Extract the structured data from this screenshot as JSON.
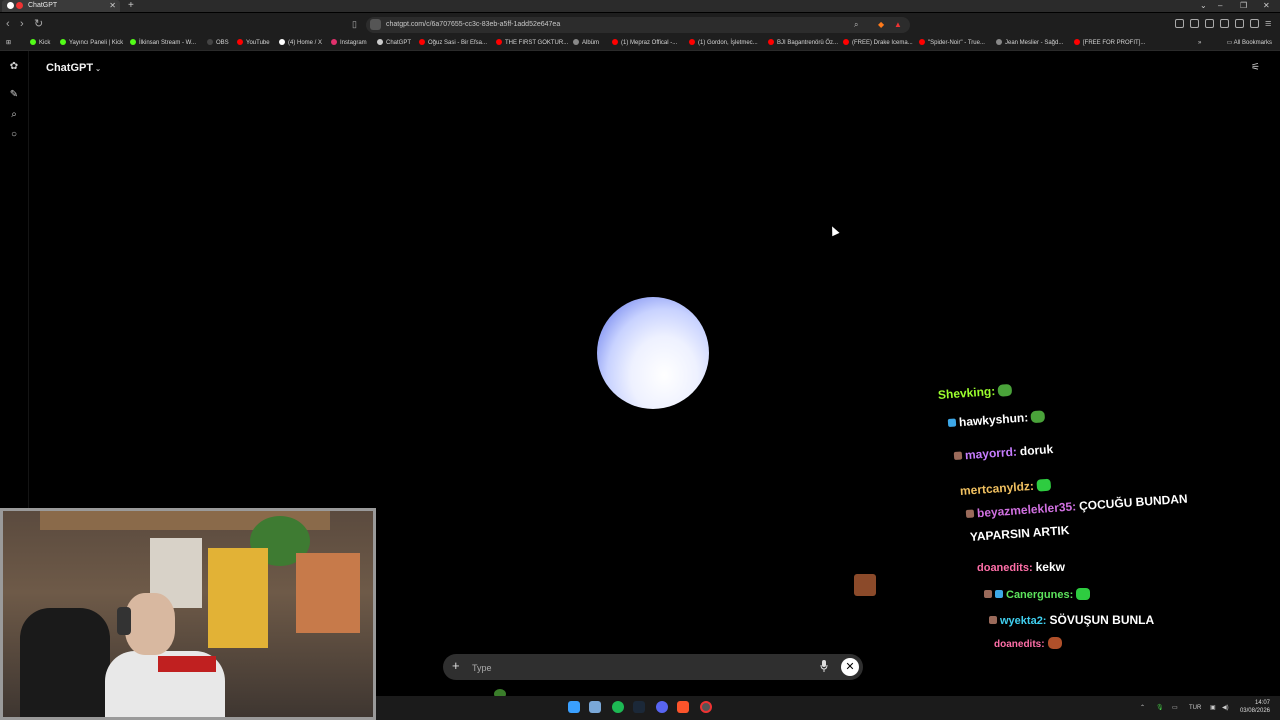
{
  "browser": {
    "tab_title": "ChatGPT",
    "new_tab": "+",
    "url": "chatgpt.com/c/6a707655-cc3c-83eb-a5ff-1add52e647ea",
    "bookmarks": [
      {
        "label": "Kick",
        "color": "#53fc18"
      },
      {
        "label": "Yayıncı Paneli | Kick",
        "color": "#53fc18"
      },
      {
        "label": "İlkinsan Stream - W...",
        "color": "#53fc18"
      },
      {
        "label": "OBS",
        "color": "#444444"
      },
      {
        "label": "YouTube",
        "color": "#ff0000"
      },
      {
        "label": "(4) Home / X",
        "color": "#ffffff"
      },
      {
        "label": "Instagram",
        "color": "#e1306c"
      },
      {
        "label": "ChatGPT",
        "color": "#cccccc"
      },
      {
        "label": "Oğuz Sasi - Bir Efsa...",
        "color": "#ff0000"
      },
      {
        "label": "THE FIRST GOKTUR...",
        "color": "#ff0000"
      },
      {
        "label": "Albüm",
        "color": "#888888"
      },
      {
        "label": "(1) Mepraz Offical -...",
        "color": "#ff0000"
      },
      {
        "label": "(1) Gordon, İşletmec...",
        "color": "#ff0000"
      },
      {
        "label": "BJI Bagantrenörü Öz...",
        "color": "#ff0000"
      },
      {
        "label": "(FREE) Drake Icema...",
        "color": "#ff0000"
      },
      {
        "label": "\"Spider-Noir\" - True...",
        "color": "#ff0000"
      },
      {
        "label": "Jean Meslier - Sağd...",
        "color": "#888888"
      },
      {
        "label": "[FREE FOR PROFIT]...",
        "color": "#ff0000"
      }
    ],
    "all_bookmarks": "All Bookmarks"
  },
  "app": {
    "brand": "ChatGPT",
    "caret": "⌄"
  },
  "composer": {
    "plus": "+",
    "placeholder": "Type",
    "end_symbol": "✕"
  },
  "chat_overlay": [
    {
      "user": "Shevking:",
      "user_color": "#9cff2e",
      "text": "",
      "emote": "pepe"
    },
    {
      "user": "hawkyshun:",
      "user_color": "#ffffff",
      "text": "",
      "emote": "pepe"
    },
    {
      "user": "mayorrd:",
      "user_color": "#c77dff",
      "text": "doruk",
      "emote": ""
    },
    {
      "user": "mertcanyldz:",
      "user_color": "#f0c060",
      "text": "",
      "emote": "green"
    },
    {
      "user": "beyazmelekler35:",
      "user_color": "#d070e0",
      "text": "ÇOCUĞU BUNDAN",
      "text2": "YAPARSIN ARTIK",
      "emote": ""
    },
    {
      "user": "doanedits:",
      "user_color": "#ff6fa8",
      "text": "kekw",
      "emote": ""
    },
    {
      "user": "Canergunes:",
      "user_color": "#5de35d",
      "text": "",
      "emote": "green"
    },
    {
      "user": "wyekta2:",
      "user_color": "#40d0f0",
      "text": "SÖVUŞUN BUNLA",
      "emote": ""
    },
    {
      "user": "doanedits:",
      "user_color": "#ff6fa8",
      "text": "",
      "emote": "face"
    }
  ],
  "taskbar": {
    "lang": "TUR",
    "time": "14:07",
    "date": "03/08/2026"
  }
}
